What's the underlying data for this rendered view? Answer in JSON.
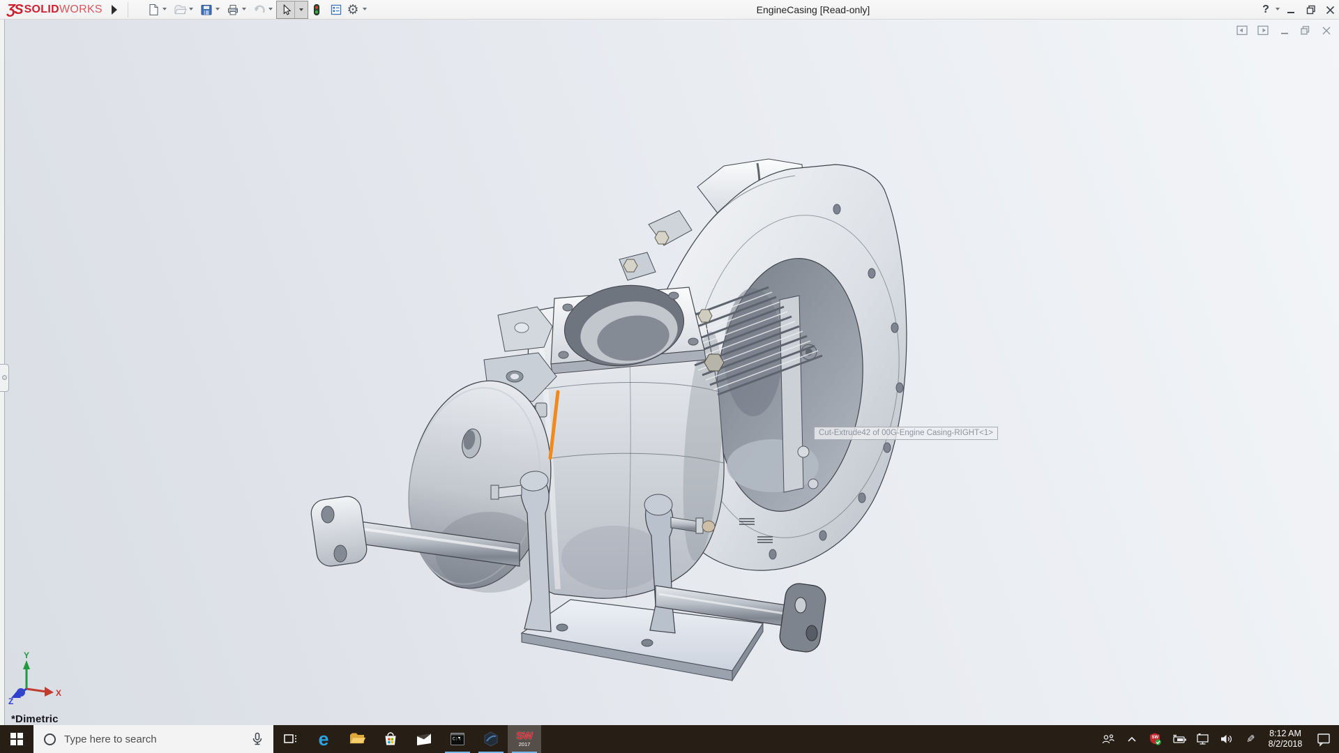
{
  "titlebar": {
    "logo_monogram": "ƷS",
    "brand_bold": "SOLID",
    "brand_light": "WORKS",
    "title": "EngineCasing [Read-only]",
    "help_glyph": "?",
    "toolbar_icons": [
      "new-document",
      "open-document",
      "save",
      "print",
      "undo",
      "select-cursor",
      "rebuild-traffic-light",
      "display-report",
      "options-gear"
    ],
    "window_controls": [
      "minimize",
      "restore",
      "close"
    ]
  },
  "document_window": {
    "controls": [
      "dock-pane-left",
      "dock-pane-right",
      "minimize",
      "restore",
      "close"
    ]
  },
  "viewport": {
    "tooltip_text": "Cut-Extrude42 of 00G-Engine Casing-RIGHT<1>",
    "view_orientation": "*Dimetric",
    "triad": {
      "x_label": "X",
      "y_label": "Y",
      "z_label": "Z"
    },
    "selection_highlight_color": "#F08A1D"
  },
  "taskbar": {
    "search": {
      "placeholder": "Type here to search"
    },
    "app_icons": [
      "task-view",
      "edge",
      "file-explorer",
      "microsoft-store",
      "mail",
      "command-prompt",
      "solidworks-tool",
      "solidworks-2017"
    ],
    "open_apps": [
      "command-prompt",
      "solidworks-tool",
      "solidworks-2017"
    ],
    "active_app": "solidworks-2017",
    "edge_glyph": "e",
    "command_prompt_text": "C:\\",
    "solidworks_badge": {
      "letters": "SW",
      "year": "2017"
    },
    "tray_icons": [
      "people",
      "chevron-up",
      "solidworks-resource-monitor",
      "battery",
      "network-display",
      "volume",
      "pen",
      "action-center"
    ],
    "clock": {
      "time": "8:12 AM",
      "date": "8/2/2018"
    }
  },
  "glyphs": {
    "gear": "⚙",
    "pen": "✎"
  },
  "colors": {
    "titlebar_bg": "#F5F5F5",
    "logo_red": "#CF2030",
    "viewport_top": "#F3F5F8",
    "viewport_bottom": "#D9DDE4",
    "taskbar_bg": "#271E16",
    "taskbar_underline": "#79B8E8",
    "selection_orange": "#F08A1D",
    "triad_x": "#C23B2F",
    "triad_y": "#1F9A3D",
    "triad_z": "#2D3FD0"
  }
}
